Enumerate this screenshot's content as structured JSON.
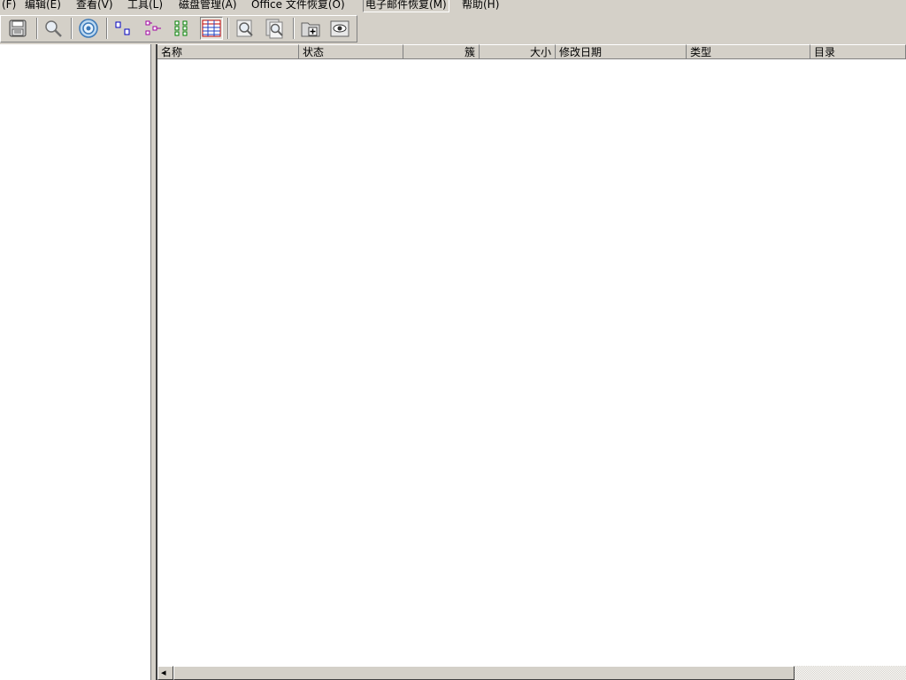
{
  "menu": {
    "file": "(F)",
    "edit": "编辑(E)",
    "view": "查看(V)",
    "tools": "工具(L)",
    "disk": "磁盘管理(A)",
    "office": "Office 文件恢复(O)",
    "email": "电子邮件恢复(M)",
    "help": "帮助(H)"
  },
  "toolbar": {
    "icons": [
      "save-icon",
      "search-icon",
      "scan-icon",
      "file-view-icon",
      "tree-view-icon",
      "details-view-icon",
      "list-view-icon",
      "find-icon",
      "find-next-icon",
      "new-folder-icon",
      "preview-icon"
    ]
  },
  "list": {
    "columns": {
      "name": "名称",
      "status": "状态",
      "cluster": "簇",
      "size": "大小",
      "modified": "修改日期",
      "type": "类型",
      "dir": "目录"
    },
    "rows": []
  },
  "scrollbar": {
    "left_arrow": "◂"
  },
  "colors": {
    "face": "#d4d0c8",
    "shadow": "#808080",
    "highlight": "#ffffff",
    "window": "#ffffff"
  }
}
